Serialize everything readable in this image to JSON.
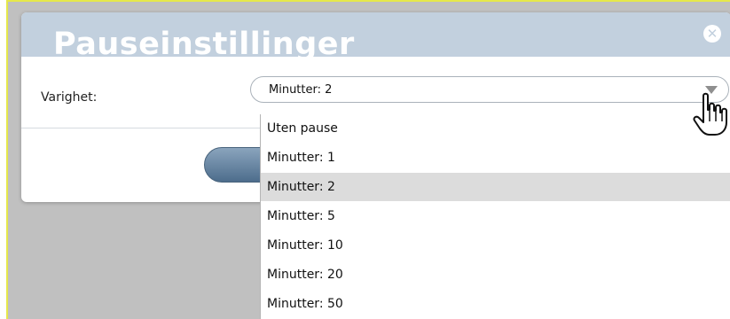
{
  "dialog": {
    "title": "Pauseinstillinger",
    "close_icon": "close-circle-icon"
  },
  "form": {
    "duration_label": "Varighet:",
    "selected_value": "Minutter: 2"
  },
  "dropdown": {
    "options": [
      "Uten pause",
      "Minutter: 1",
      "Minutter: 2",
      "Minutter: 5",
      "Minutter: 10",
      "Minutter: 20",
      "Minutter: 50"
    ],
    "selected_index": 2,
    "highlight_color": "#dcdcdc"
  },
  "colors": {
    "header": "#c2d0de",
    "button": "#5f7f9e",
    "outer_border": "#e6e84a"
  }
}
